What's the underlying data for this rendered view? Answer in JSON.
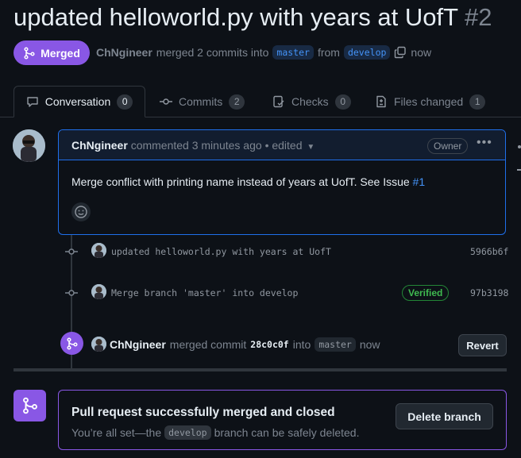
{
  "pr": {
    "title": "updated helloworld.py with years at UofT",
    "number": "#2",
    "state_label": "Merged",
    "author": "ChNgineer",
    "merged_text": "merged 2 commits into",
    "base_branch": "master",
    "from_text": "from",
    "head_branch": "develop",
    "time": "now"
  },
  "tabs": [
    {
      "label": "Conversation",
      "count": "0",
      "icon": "comment-icon"
    },
    {
      "label": "Commits",
      "count": "2",
      "icon": "commit-icon"
    },
    {
      "label": "Checks",
      "count": "0",
      "icon": "checklist-icon"
    },
    {
      "label": "Files changed",
      "count": "1",
      "icon": "file-diff-icon"
    }
  ],
  "comment": {
    "author": "ChNgineer",
    "action": "commented 3 minutes ago",
    "edited": "• edited",
    "role": "Owner",
    "body": "Merge conflict with printing name instead of years at UofT. See Issue",
    "issue_link": "#1"
  },
  "commits": [
    {
      "message": "updated helloworld.py with years at UofT",
      "sha": "5966b6f",
      "verified": ""
    },
    {
      "message": "Merge branch 'master' into develop",
      "sha": "97b3198",
      "verified": "Verified"
    }
  ],
  "merge_event": {
    "author": "ChNgineer",
    "text": "merged commit",
    "sha": "28c0c0f",
    "into": "into",
    "branch": "master",
    "time": "now",
    "revert_label": "Revert"
  },
  "merged_box": {
    "heading": "Pull request successfully merged and closed",
    "text_before": "You’re all set—the",
    "branch": "develop",
    "text_after": "branch can be safely deleted.",
    "delete_label": "Delete branch"
  },
  "colors": {
    "background": "#0d1117",
    "merged_purple": "#8957e5",
    "link_blue": "#4493f8",
    "verified_green": "#3fb950"
  }
}
